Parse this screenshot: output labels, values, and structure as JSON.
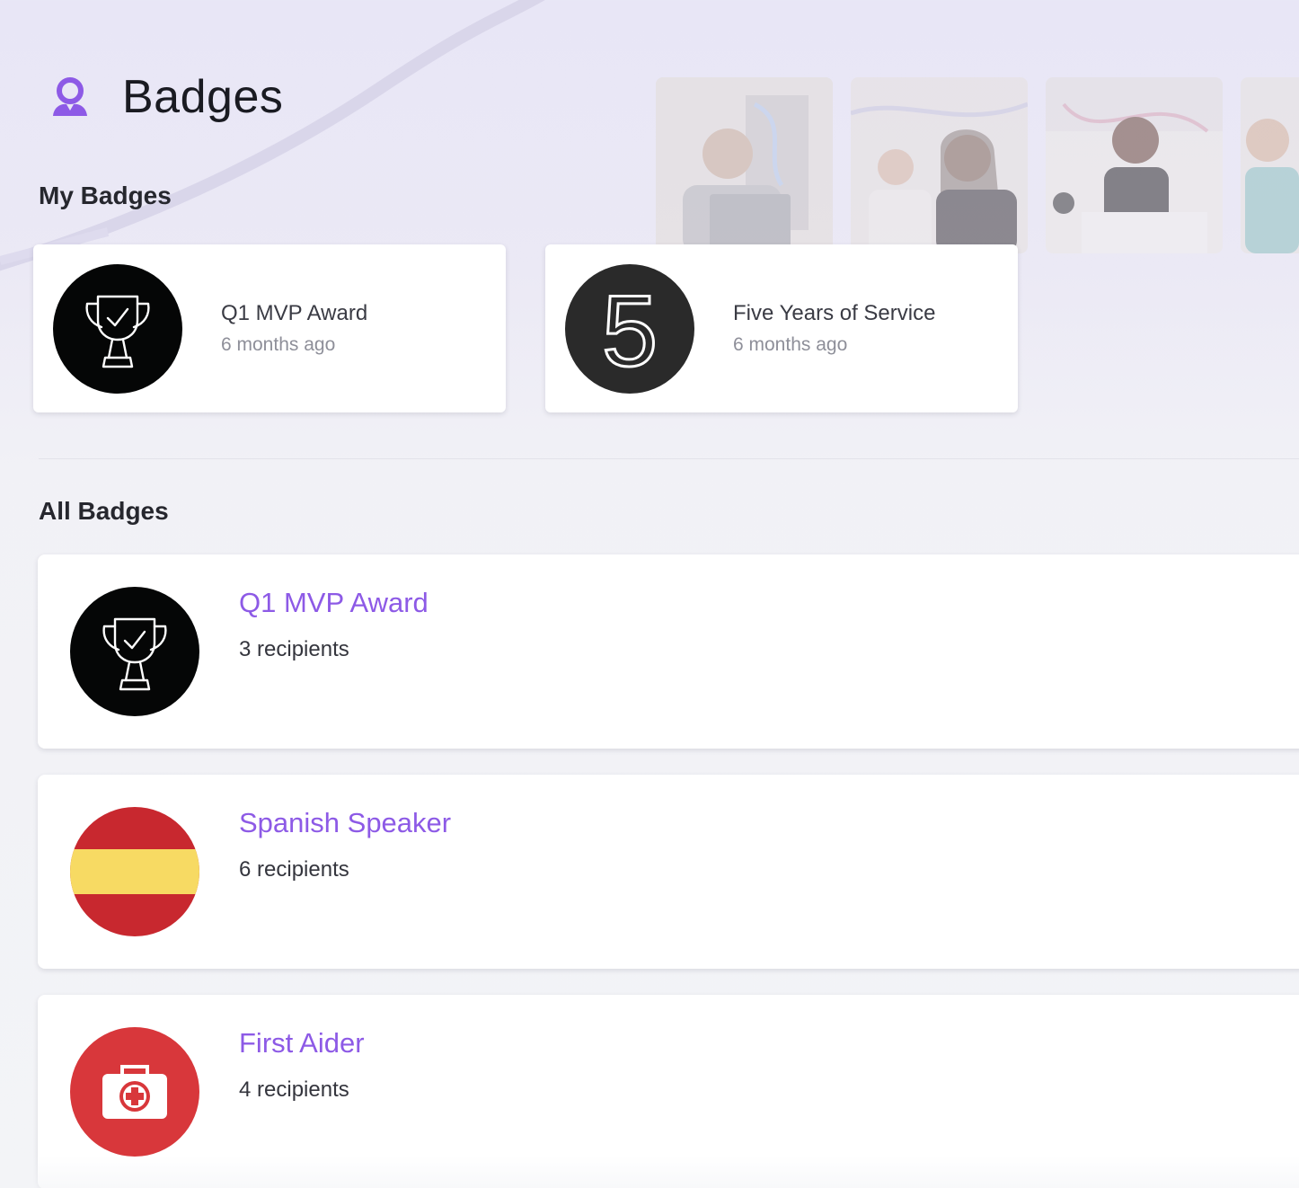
{
  "header": {
    "title": "Badges",
    "icon": "badge-person-icon",
    "accent": "#8d5ae6"
  },
  "my_badges": {
    "title": "My Badges",
    "items": [
      {
        "name": "Q1 MVP Award",
        "time": "6 months ago",
        "icon": "trophy-icon"
      },
      {
        "name": "Five Years of Service",
        "time": "6 months ago",
        "icon": "number-five-icon"
      }
    ]
  },
  "all_badges": {
    "title": "All Badges",
    "items": [
      {
        "name": "Q1 MVP Award",
        "recipients": "3 recipients",
        "icon": "trophy-icon"
      },
      {
        "name": "Spanish Speaker",
        "recipients": "6 recipients",
        "icon": "spain-flag-icon"
      },
      {
        "name": "First Aider",
        "recipients": "4 recipients",
        "icon": "first-aid-kit-icon"
      }
    ]
  },
  "colors": {
    "link": "#8d5ae6",
    "trophy_bg": "#050606",
    "five_bg": "#2a2a2a",
    "flag_red": "#c8282f",
    "flag_yellow": "#f7da63",
    "first_aid_red": "#d8373b"
  }
}
